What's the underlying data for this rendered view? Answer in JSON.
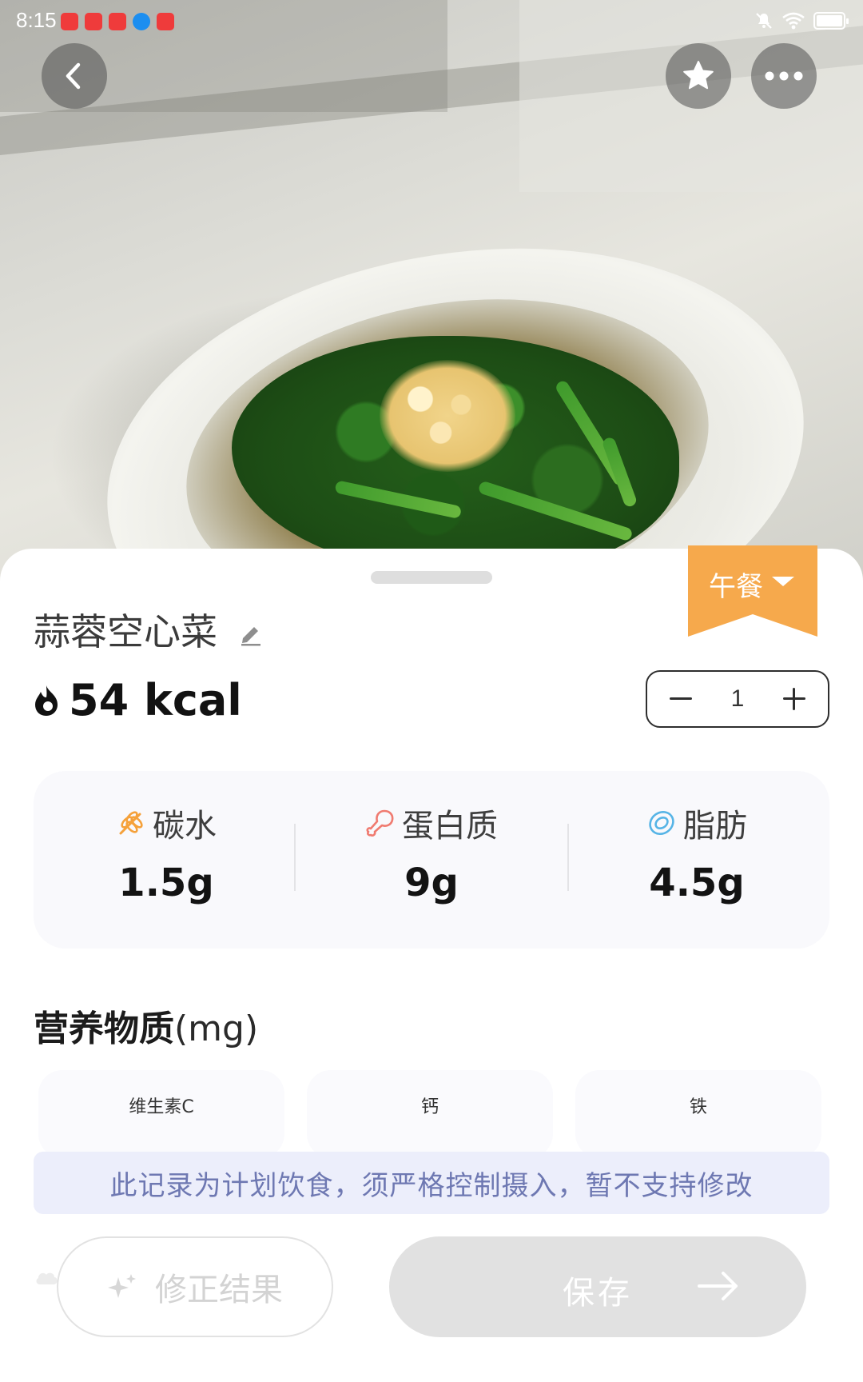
{
  "status_bar": {
    "time": "8:15",
    "notification_icons": [
      "app-notification-icon",
      "app-notification-icon",
      "app-notification-icon",
      "browser-notification-icon",
      "app-notification-icon"
    ],
    "right_icons": [
      "mute-icon",
      "wifi-icon",
      "battery-icon"
    ]
  },
  "top_actions": {
    "back": "chevron-left-icon",
    "favorite": "star-icon",
    "more": "more-horizontal-icon"
  },
  "food": {
    "name": "蒜蓉空心菜",
    "calories": "54 kcal",
    "meal": "午餐",
    "quantity": "1"
  },
  "macros": [
    {
      "label": "碳水",
      "value": "1.5g",
      "icon": "wheat-icon",
      "color": "#f5a13a"
    },
    {
      "label": "蛋白质",
      "value": "9g",
      "icon": "drumstick-icon",
      "color": "#f07b70"
    },
    {
      "label": "脂肪",
      "value": "4.5g",
      "icon": "fat-drop-icon",
      "color": "#56b4e6"
    }
  ],
  "nutrients": {
    "title": "营养物质",
    "unit": "(mg)",
    "items": [
      "维生素C",
      "钙",
      "铁"
    ]
  },
  "notice": "此记录为计划饮食，须严格控制摄入，暂不支持修改",
  "actions": {
    "correct_label": "修正结果",
    "save_label": "保存"
  },
  "colors": {
    "meal_ribbon": "#f6a94c",
    "notice_bg": "#eceefb",
    "notice_text": "#6e78b2",
    "disabled_button": "#e1e1e1"
  }
}
